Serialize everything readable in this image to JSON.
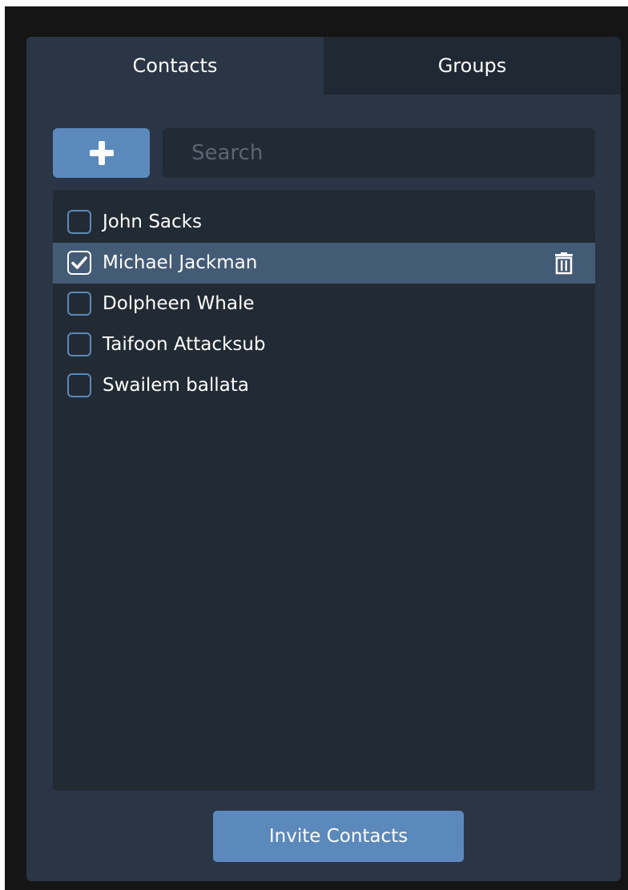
{
  "tabs": {
    "contacts_label": "Contacts",
    "groups_label": "Groups",
    "active": "Contacts"
  },
  "toolbar": {
    "add_icon": "plus-icon"
  },
  "search": {
    "placeholder": "Search",
    "value": ""
  },
  "contacts": [
    {
      "name": "John Sacks",
      "checked": false
    },
    {
      "name": "Michael Jackman",
      "checked": true,
      "selected": true,
      "row_icon": "trash-icon"
    },
    {
      "name": "Dolpheen Whale",
      "checked": false
    },
    {
      "name": "Taifoon Attacksub",
      "checked": false
    },
    {
      "name": "Swailem ballata",
      "checked": false
    }
  ],
  "footer": {
    "invite_label": "Invite Contacts"
  },
  "colors": {
    "accent": "#5b89bc",
    "panel": "#2a3646",
    "list_bg": "#222a34",
    "selected_row": "#445b75",
    "outer_frame": "#151515"
  }
}
